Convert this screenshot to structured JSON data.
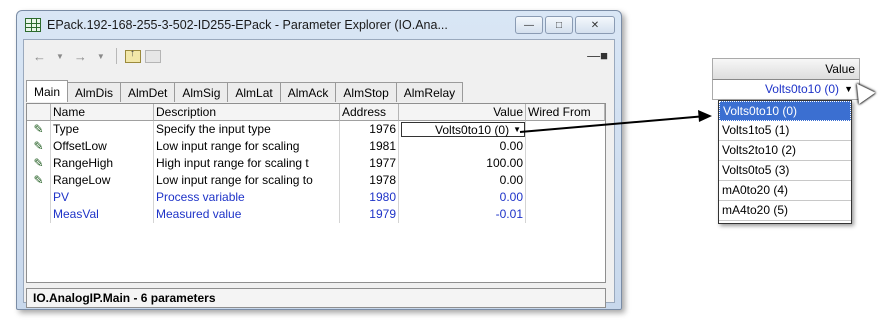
{
  "window": {
    "title": "EPack.192-168-255-3-502-ID255-EPack - Parameter Explorer (IO.Ana...",
    "min_glyph": "—",
    "max_glyph": "□",
    "close_glyph": "✕"
  },
  "toolbar": {
    "back": "←",
    "back_dropdown": "▼",
    "forward": "→",
    "forward_dropdown": "▼",
    "pin": "—■"
  },
  "tabs": [
    "Main",
    "AlmDis",
    "AlmDet",
    "AlmSig",
    "AlmLat",
    "AlmAck",
    "AlmStop",
    "AlmRelay"
  ],
  "columns": {
    "name": "Name",
    "description": "Description",
    "address": "Address",
    "value": "Value",
    "wired_from": "Wired From"
  },
  "rows": [
    {
      "editable": true,
      "name": "Type",
      "description": "Specify the input type",
      "address": "1976",
      "value": "Volts0to10 (0)",
      "wired": "",
      "highlight": false
    },
    {
      "editable": true,
      "name": "OffsetLow",
      "description": "Low input range for scaling",
      "address": "1981",
      "value": "0.00",
      "wired": "",
      "highlight": false
    },
    {
      "editable": true,
      "name": "RangeHigh",
      "description": "High input range for scaling t",
      "address": "1977",
      "value": "100.00",
      "wired": "",
      "highlight": false
    },
    {
      "editable": true,
      "name": "RangeLow",
      "description": "Low input range for scaling to",
      "address": "1978",
      "value": "0.00",
      "wired": "",
      "highlight": false
    },
    {
      "editable": false,
      "name": "PV",
      "description": "Process variable",
      "address": "1980",
      "value": "0.00",
      "wired": "",
      "highlight": true
    },
    {
      "editable": false,
      "name": "MeasVal",
      "description": "Measured value",
      "address": "1979",
      "value": "-0.01",
      "wired": "",
      "highlight": true
    }
  ],
  "status_bar": "IO.AnalogIP.Main  -  6 parameters",
  "popout": {
    "header": "Value",
    "current": "Volts0to10 (0)",
    "options": [
      "Volts0to10 (0)",
      "Volts1to5 (1)",
      "Volts2to10 (2)",
      "Volts0to5 (3)",
      "mA0to20 (4)",
      "mA4to20 (5)"
    ],
    "selected_index": 0
  },
  "colors": {
    "link_blue": "#1e33c8",
    "selection": "#3b6fd1",
    "editable_pencil": "#1d5a1d"
  }
}
